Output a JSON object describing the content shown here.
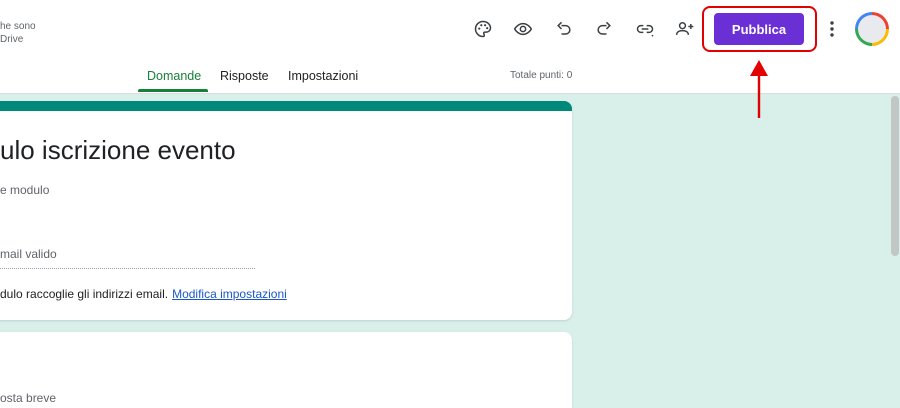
{
  "header": {
    "save_note_line1": "he sono",
    "save_note_line2": "Drive",
    "publish_label": "Pubblica",
    "icons": [
      "palette-icon",
      "eye-icon",
      "undo-icon",
      "redo-icon",
      "link-icon",
      "add-person-icon",
      "more-vert-icon"
    ]
  },
  "tabs": {
    "items": [
      {
        "label": "Domande",
        "active": true
      },
      {
        "label": "Risposte",
        "active": false
      },
      {
        "label": "Impostazioni",
        "active": false
      }
    ],
    "total_points": "Totale punti: 0"
  },
  "form": {
    "title": "ulo iscrizione evento",
    "description_placeholder": "e modulo",
    "email_placeholder": "mail valido",
    "email_note": "dulo raccoglie gli indirizzi email.",
    "email_note_link": "Modifica impostazioni",
    "question2_type_hint": "osta breve"
  },
  "colors": {
    "publish": "#6b2fd6",
    "accent_green": "#188038",
    "card_top_border": "#00897b",
    "background": "#d9efe9",
    "annotation_red": "#e20000"
  }
}
